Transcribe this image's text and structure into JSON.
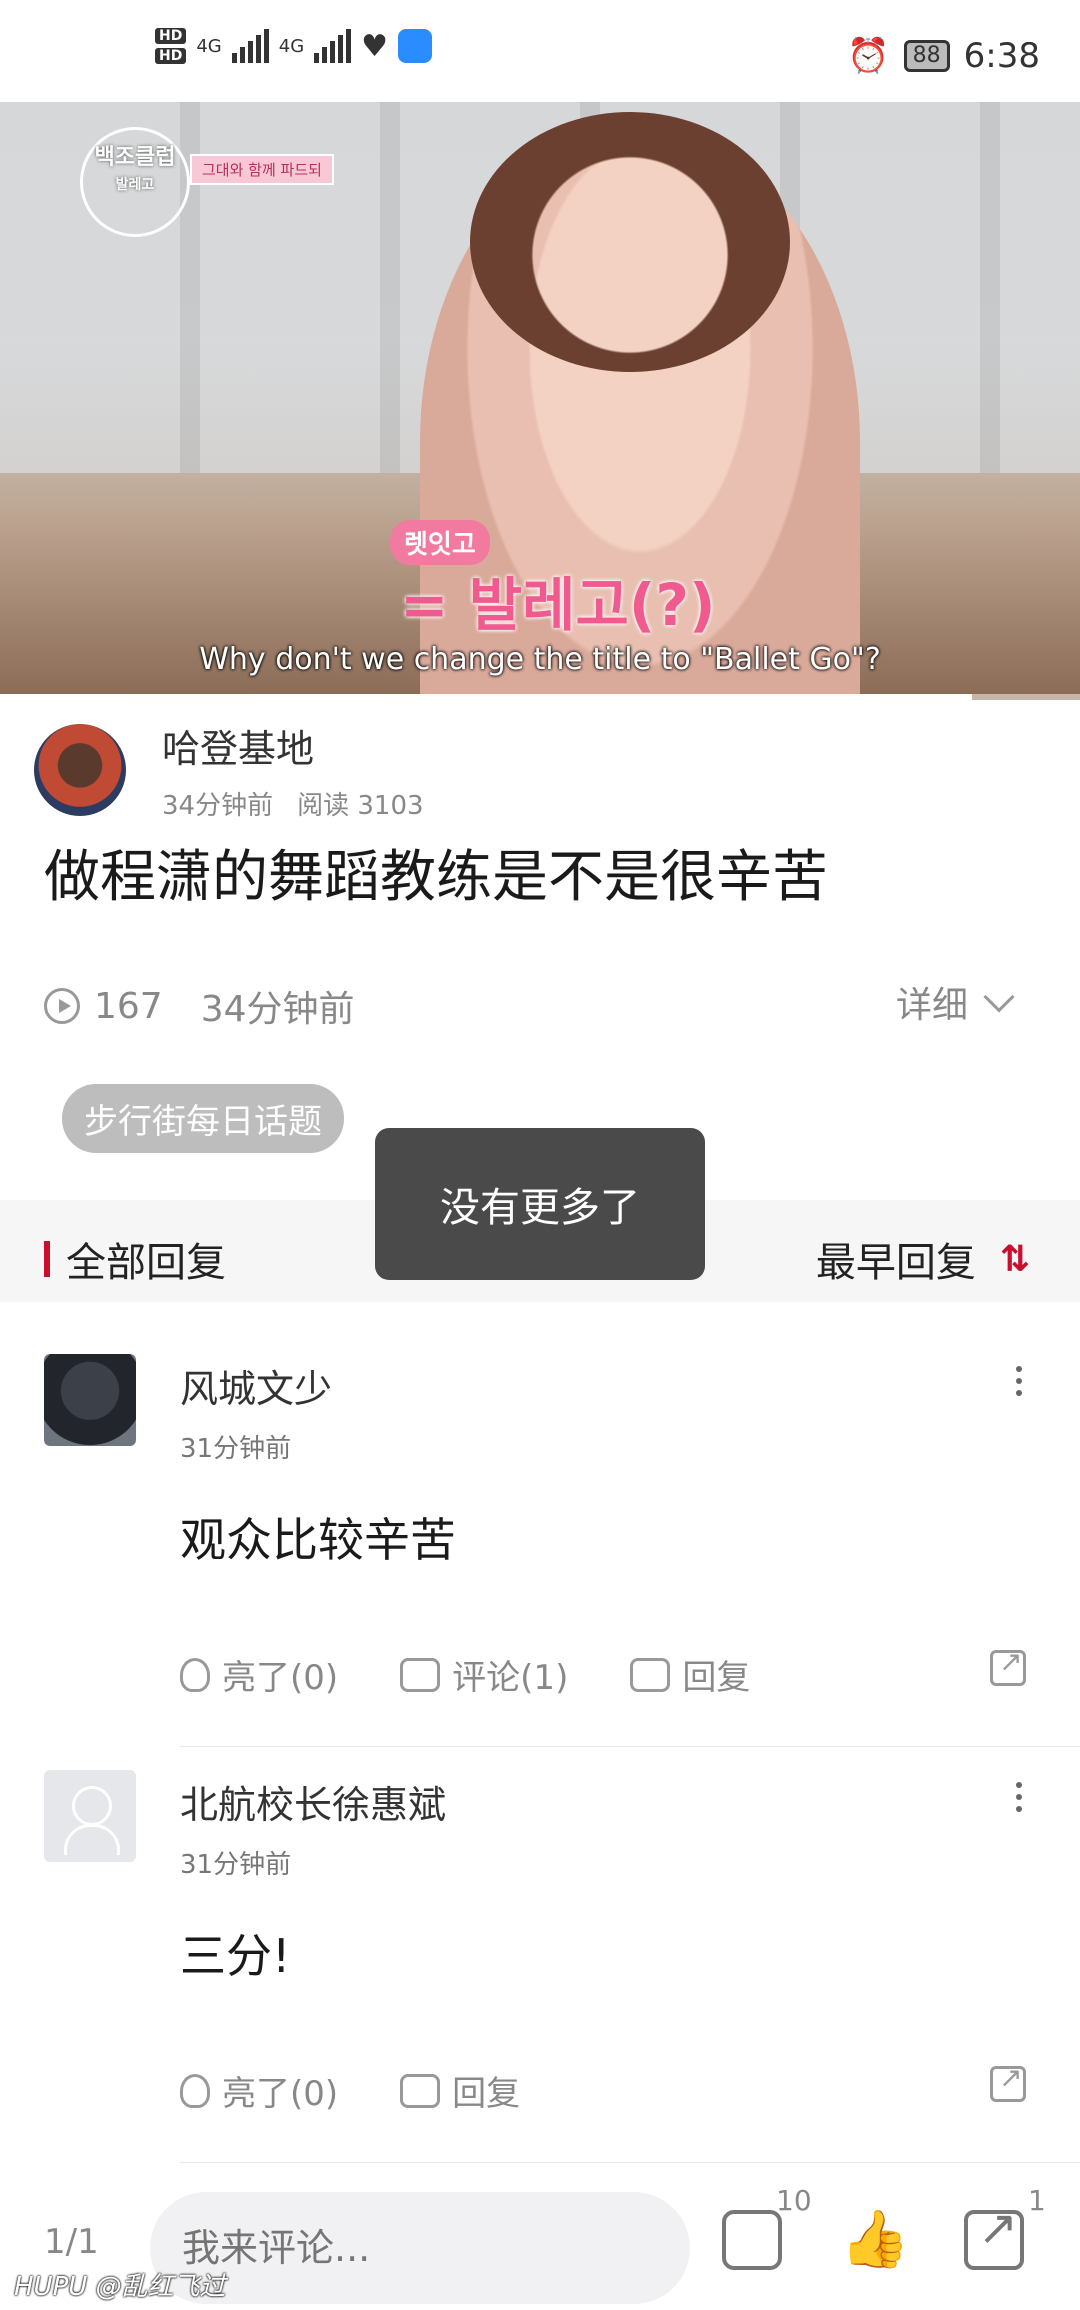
{
  "status_bar": {
    "network_left": "HD",
    "network_right": "HD",
    "net1": "4G",
    "net2": "4G",
    "battery": "88",
    "time": "6:38"
  },
  "video": {
    "logo_text": "백조클럽",
    "logo_sub": "발레고",
    "pink_tag": "그대와 함께 파드되",
    "korean_sub_small": "렛잇고",
    "korean_sub_big": "= 발레고(?)",
    "english_sub": "Why don't we change the title to \"Ballet Go\"?",
    "progress": 0.9
  },
  "author": {
    "name": "哈登基地",
    "posted": "34分钟前",
    "reads": "阅读 3103"
  },
  "post_title": "做程潇的舞蹈教练是不是很辛苦",
  "stats": {
    "plays": "167",
    "time": "34分钟前",
    "detail": "详细"
  },
  "topic_tag": "步行街每日话题",
  "toast": "没有更多了",
  "reply_header": {
    "all": "全部回复",
    "sort": "最早回复",
    "sort_icon": "⇅"
  },
  "comments": [
    {
      "name": "风城文少",
      "time": "31分钟前",
      "text": "观众比较辛苦",
      "like": "亮了(0)",
      "comment": "评论(1)",
      "reply": "回复"
    },
    {
      "name": "北航校长徐惠斌",
      "time": "31分钟前",
      "text": "三分!",
      "like": "亮了(0)",
      "reply": "回复"
    }
  ],
  "bottom_bar": {
    "page": "1/1",
    "input_placeholder": "我来评论...",
    "comment_count": "10",
    "share_count": "1",
    "watermark": "HUPU @乱红飞过"
  }
}
